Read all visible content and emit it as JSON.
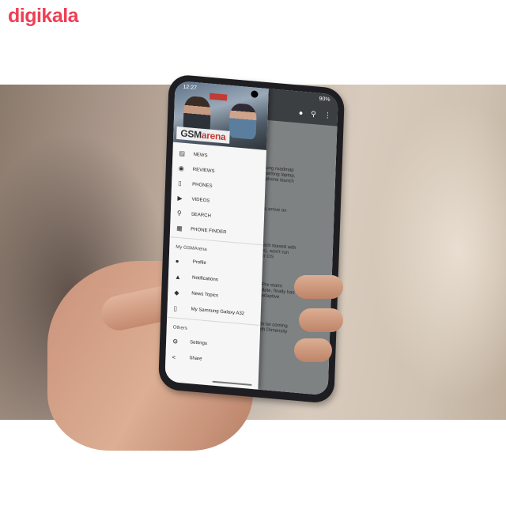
{
  "watermark": {
    "logo_text": "digikala",
    "color": "#ef3f55"
  },
  "phone": {
    "status": {
      "time": "12:27",
      "battery": "90%"
    },
    "app": {
      "brand_prefix": "GSM",
      "brand_suffix": "arena",
      "brand_accent_color": "#c33b36",
      "menu": [
        {
          "label": "NEWS",
          "icon": "news-icon"
        },
        {
          "label": "REVIEWS",
          "icon": "eye-icon"
        },
        {
          "label": "PHONES",
          "icon": "phone-icon"
        },
        {
          "label": "VIDEOS",
          "icon": "play-icon"
        },
        {
          "label": "SEARCH",
          "icon": "search-icon"
        },
        {
          "label": "PHONE FINDER",
          "icon": "finder-icon"
        }
      ],
      "my_section": {
        "title": "My GSMArena",
        "items": [
          {
            "label": "Profile",
            "icon": "person-icon"
          },
          {
            "label": "Notifications",
            "icon": "bell-icon"
          },
          {
            "label": "News Topics",
            "icon": "tag-icon"
          },
          {
            "label": "My Samsung Galaxy A32",
            "icon": "device-icon"
          }
        ]
      },
      "others_section": {
        "title": "Others",
        "items": [
          {
            "label": "Settings",
            "icon": "gear-icon"
          },
          {
            "label": "Share",
            "icon": "share-icon"
          }
        ]
      },
      "background_snippets": [
        "ung roadmap\nsetting laptop,\nphone launch",
        "s arrive on",
        "ach teased with\ns), won't run\nir OS",
        "Pre starts\ndate, finally has\nadaptive",
        "to be coming\nith Dimensity"
      ]
    }
  }
}
